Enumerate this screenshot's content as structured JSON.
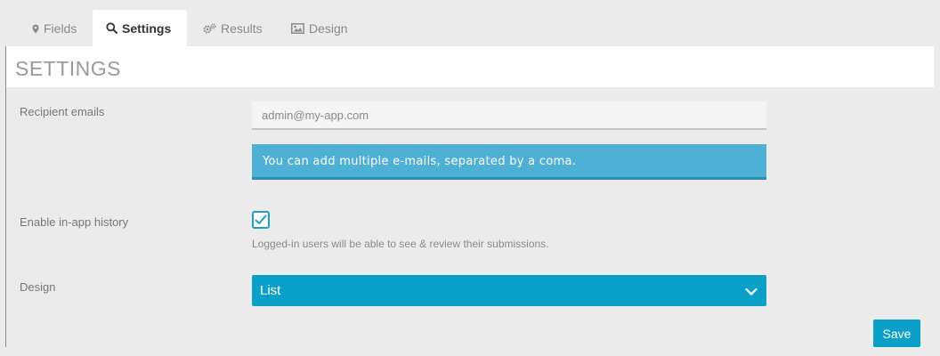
{
  "tabs": [
    {
      "label": "Fields",
      "icon": "map-marker-icon"
    },
    {
      "label": "Settings",
      "icon": "search-icon"
    },
    {
      "label": "Results",
      "icon": "gears-icon"
    },
    {
      "label": "Design",
      "icon": "image-icon"
    }
  ],
  "active_tab": "Settings",
  "section": {
    "title": "SETTINGS"
  },
  "recipient": {
    "label": "Recipient emails",
    "placeholder": "admin@my-app.com",
    "value": "",
    "info": "You can add multiple e-mails, separated by a coma."
  },
  "history": {
    "label": "Enable in-app history",
    "checked": true,
    "help": "Logged-in users will be able to see & review their submissions."
  },
  "design": {
    "label": "Design",
    "selected": "List"
  },
  "save_label": "Save",
  "colors": {
    "accent": "#0aa0c8",
    "info": "#4db0d4",
    "background": "#ebebeb"
  }
}
